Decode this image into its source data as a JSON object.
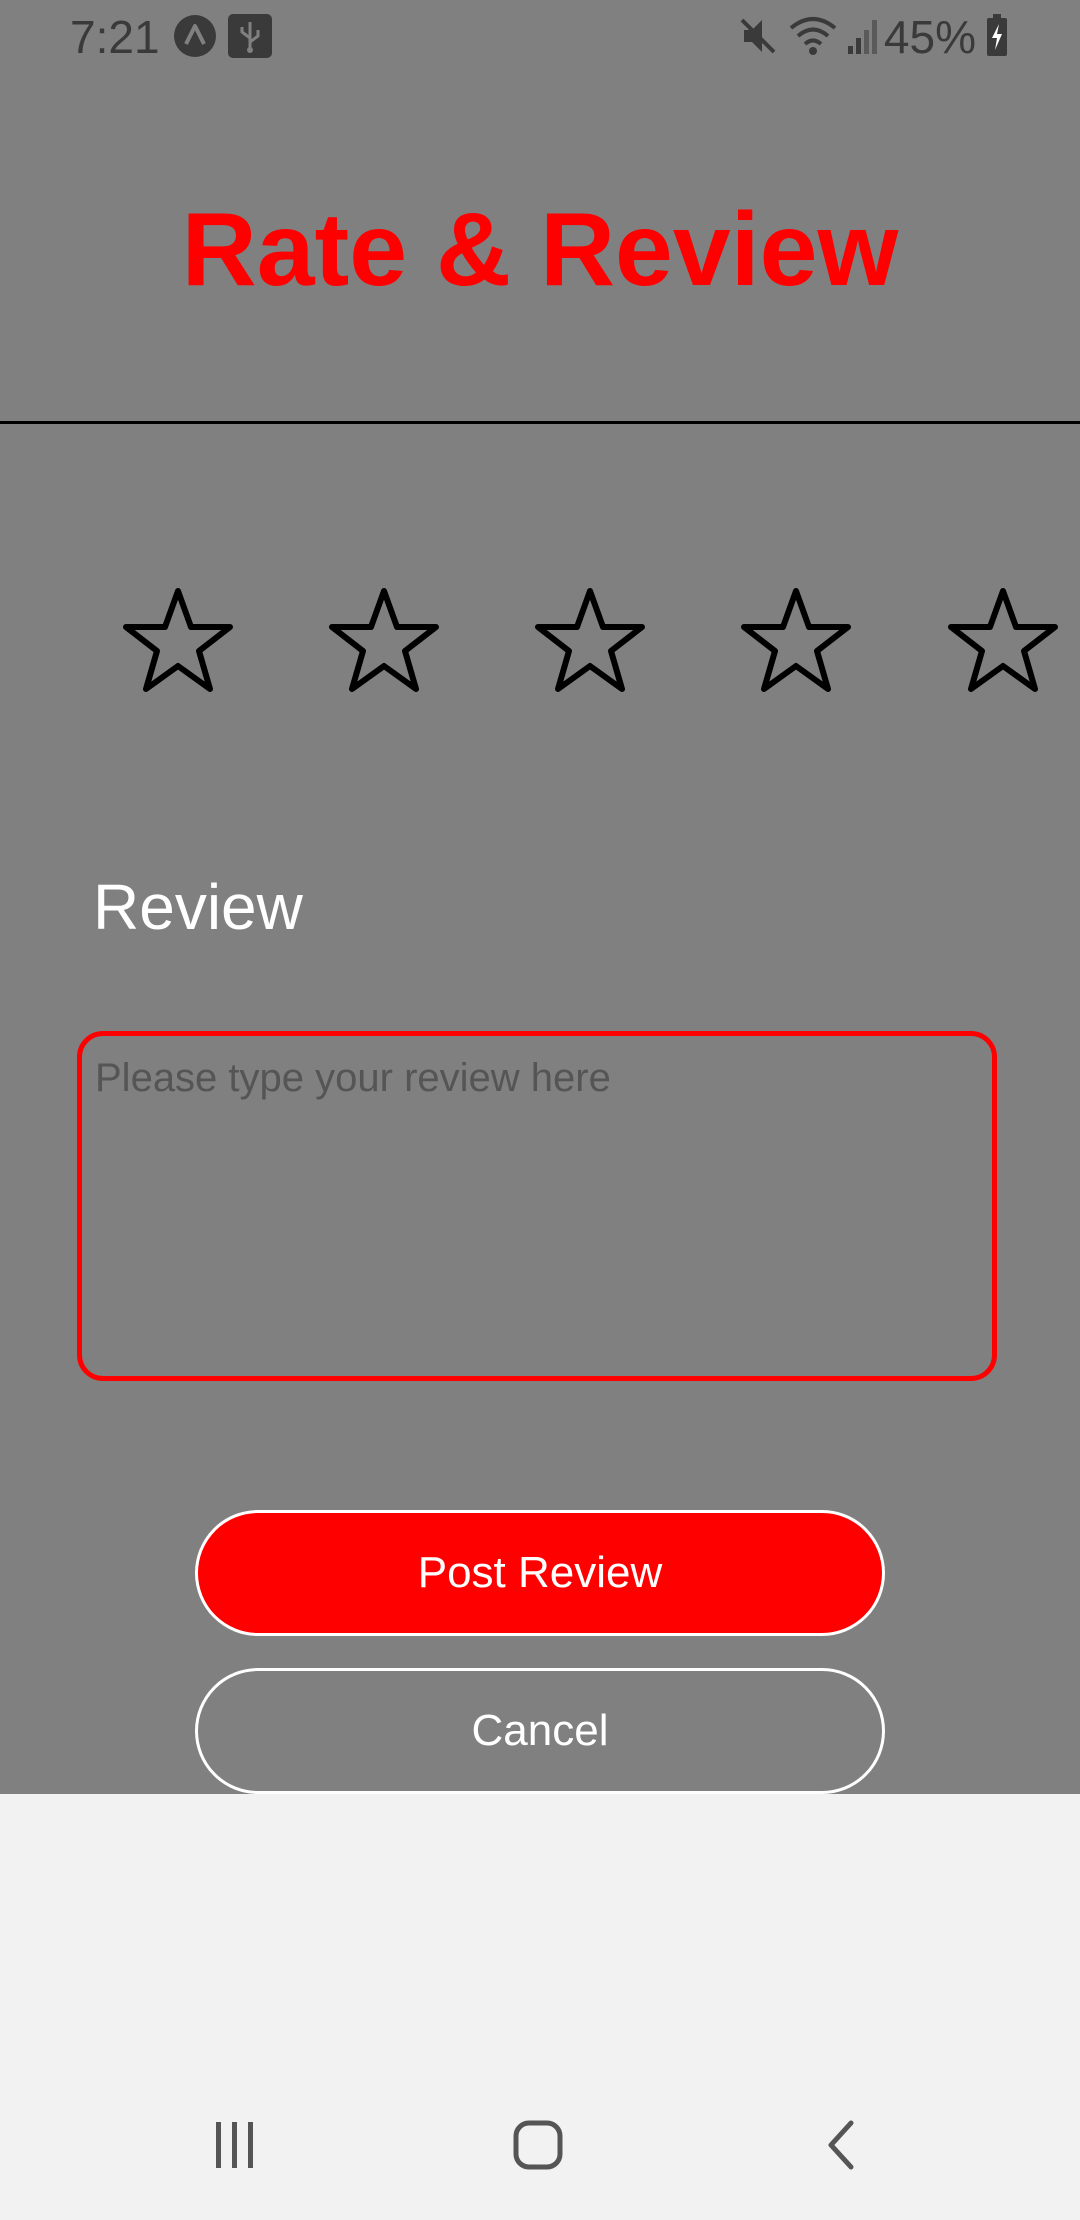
{
  "status_bar": {
    "time": "7:21",
    "battery": "45%",
    "icons": [
      "navigation-icon",
      "usb-icon",
      "mute-icon",
      "wifi-icon",
      "signal-icon",
      "battery-charging-icon"
    ]
  },
  "header": {
    "title": "Rate & Review",
    "title_color": "#ff0000"
  },
  "rating": {
    "max_stars": 5,
    "selected": 0
  },
  "review": {
    "label": "Review",
    "placeholder": "Please type your review here",
    "value": ""
  },
  "actions": {
    "post_label": "Post Review",
    "cancel_label": "Cancel",
    "accent_color": "#ff0000"
  },
  "colors": {
    "background": "#808080",
    "nav_background": "#f2f2f2"
  },
  "nav_bar": {
    "icons": [
      "recent-apps-icon",
      "home-icon",
      "back-icon"
    ]
  }
}
